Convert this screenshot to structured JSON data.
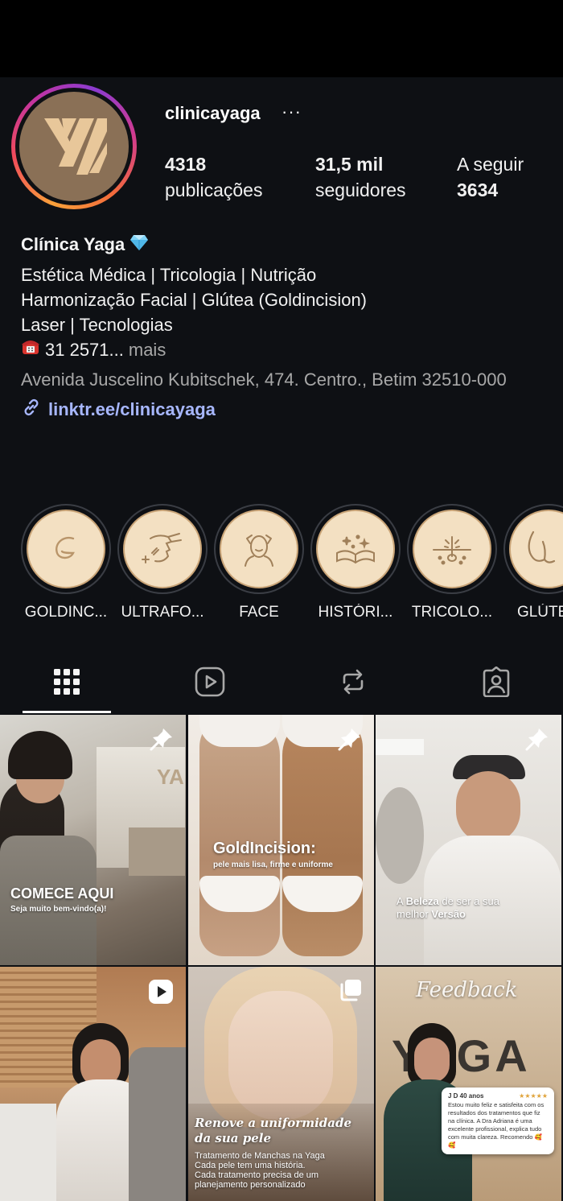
{
  "profile": {
    "username": "clinicayaga",
    "more_label": "···",
    "stats": {
      "posts_num": "4318",
      "posts_label": "publicações",
      "followers_num": "31,5 mil",
      "followers_label": "seguidores",
      "following_label": "A seguir",
      "following_num": "3634"
    }
  },
  "bio": {
    "name": "Clínica Yaga",
    "name_badge_icon": "gem-icon",
    "line1": "Estética Médica | Tricologia | Nutrição",
    "line2": "Harmonização Facial | Glútea (Goldincision)",
    "line3": "Laser | Tecnologias",
    "phone_icon": "telephone-icon",
    "phone": "31 2571...",
    "more": "mais",
    "address": "Avenida Juscelino Kubitschek, 474. Centro., Betim 32510-000",
    "link": "linktr.ee/clinicayaga"
  },
  "highlights": [
    {
      "label": "GOLDINC...",
      "icon": "swirl-g-icon"
    },
    {
      "label": "ULTRAFO...",
      "icon": "face-profile-icon"
    },
    {
      "label": "FACE",
      "icon": "face-massage-icon"
    },
    {
      "label": "HISTÓRI...",
      "icon": "open-book-icon"
    },
    {
      "label": "TRICOLO...",
      "icon": "hair-follicle-icon"
    },
    {
      "label": "GLÚTEO",
      "icon": "gluteus-icon"
    }
  ],
  "tabs": [
    {
      "name": "tab-posts-grid",
      "icon": "grid-icon",
      "active": true
    },
    {
      "name": "tab-reels",
      "icon": "reels-icon",
      "active": false
    },
    {
      "name": "tab-reposts",
      "icon": "repost-icon",
      "active": false
    },
    {
      "name": "tab-tagged",
      "icon": "tagged-user-icon",
      "active": false
    }
  ],
  "posts": {
    "p1": {
      "title": "COMECE AQUI",
      "subtitle": "Seja muito bem-vindo(a)!",
      "badge_icon": "pin-icon",
      "logo_text": "YA"
    },
    "p2": {
      "title": "GoldIncision:",
      "subtitle": "pele mais lisa, firme e uniforme",
      "badge_icon": "pin-icon"
    },
    "p3": {
      "caption_a": "A ",
      "caption_b": "Beleza",
      "caption_c": " de ser a sua",
      "caption_d": "melhor ",
      "caption_e": "Versão",
      "badge_icon": "pin-icon"
    },
    "p4": {
      "badge_icon": "reel-play-icon"
    },
    "p5": {
      "title_line1": "Renove a uniformidade",
      "title_line2": "da sua pele",
      "body1": "Tratamento de Manchas na Yaga",
      "body2": "Cada pele tem uma história.",
      "body3": "Cada tratamento precisa de um",
      "body4": "planejamento personalizado",
      "badge_icon": "carousel-icon"
    },
    "p6": {
      "script_title": "Feedback",
      "brand": "YAGA",
      "review_name": "J D 40 anos",
      "review_stars": "★★★★★",
      "review_text": "Estou muito feliz e satisfeita com os resultados dos tratamentos que fiz na clínica. A Dra Adriana é uma excelente profissional, explica tudo com muita clareza. Recomendo 🥰🥰"
    }
  },
  "colors": {
    "background": "#0e1014",
    "link": "#a7b7ff",
    "muted": "#a8a8a8",
    "highlight_bg": "#f3e0c2",
    "gold": "#c9a477"
  }
}
